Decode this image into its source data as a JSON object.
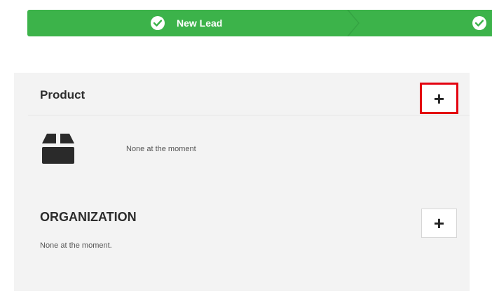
{
  "pipeline": {
    "stages": [
      {
        "label": "New Lead",
        "icon": "check-circle-icon"
      },
      {
        "label": "",
        "icon": "check-circle-icon"
      }
    ],
    "color": "#3cb34a"
  },
  "product": {
    "title": "Product",
    "add_label": "+",
    "icon": "box-icon",
    "empty_text": "None at the moment"
  },
  "organization": {
    "title": "ORGANIZATION",
    "add_label": "+",
    "empty_text": "None at the moment."
  },
  "colors": {
    "panel_bg": "#f3f3f3",
    "highlight": "#e3000f"
  }
}
